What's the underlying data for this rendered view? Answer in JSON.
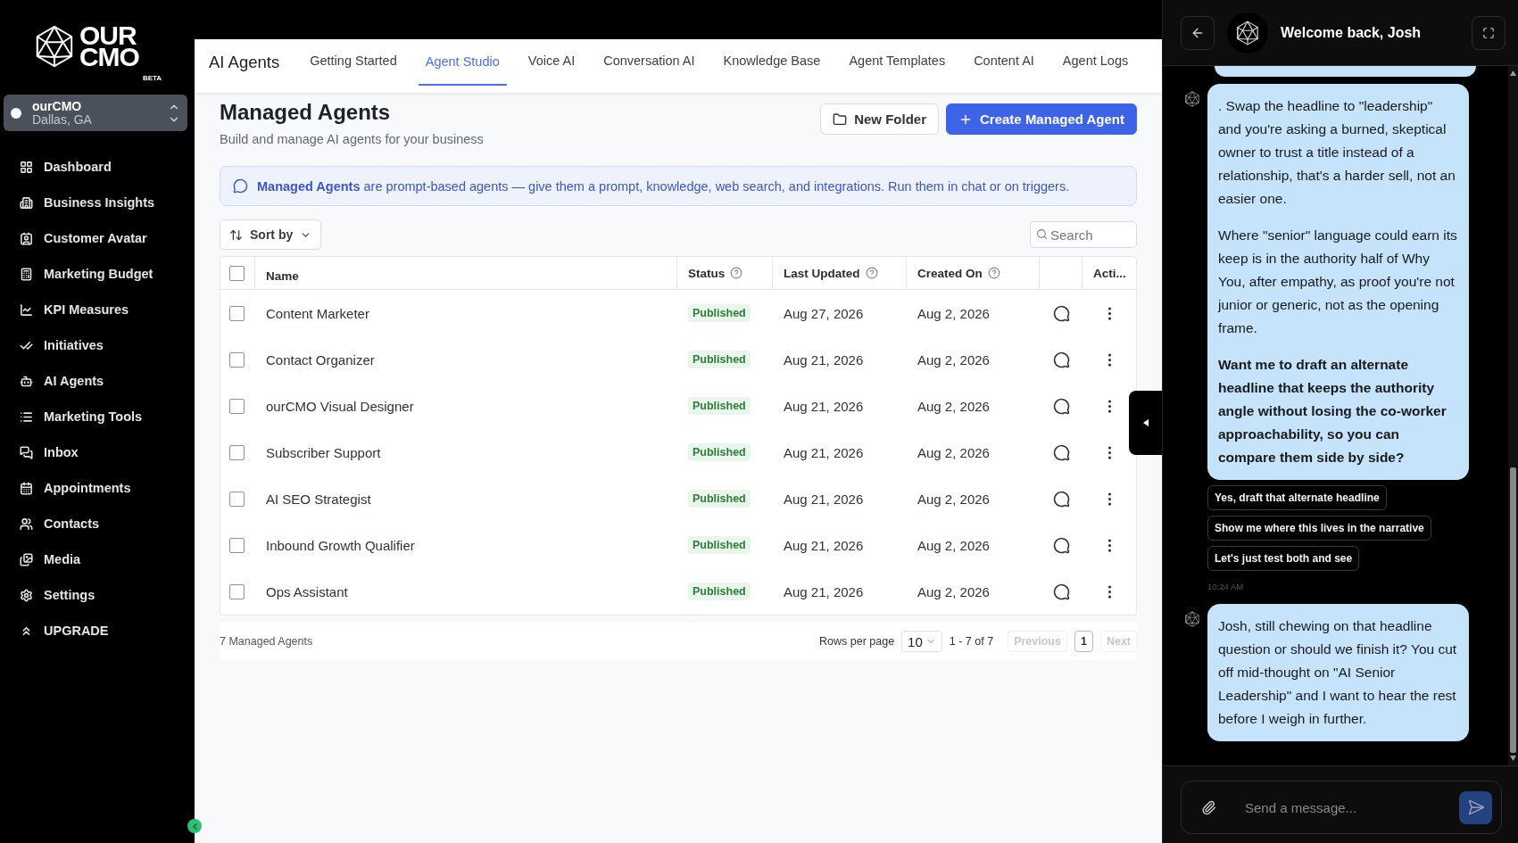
{
  "logo": {
    "line_1": "OUR",
    "line_2": "CMO",
    "badge": "BETA"
  },
  "org_switcher": {
    "name": "ourCMO",
    "location": "Dallas, GA"
  },
  "sidebar": {
    "items": [
      {
        "label": "Dashboard"
      },
      {
        "label": "Business Insights"
      },
      {
        "label": "Customer Avatar"
      },
      {
        "label": "Marketing Budget"
      },
      {
        "label": "KPI Measures"
      },
      {
        "label": "Initiatives"
      },
      {
        "label": "AI Agents"
      },
      {
        "label": "Marketing Tools"
      },
      {
        "label": "Inbox"
      },
      {
        "label": "Appointments"
      },
      {
        "label": "Contacts"
      },
      {
        "label": "Media"
      },
      {
        "label": "Settings"
      },
      {
        "label": "UPGRADE"
      }
    ]
  },
  "section_title": "AI Agents",
  "tabs": [
    {
      "label": "Getting Started",
      "selected": false
    },
    {
      "label": "Agent Studio",
      "selected": true
    },
    {
      "label": "Voice AI",
      "selected": false
    },
    {
      "label": "Conversation AI",
      "selected": false
    },
    {
      "label": "Knowledge Base",
      "selected": false
    },
    {
      "label": "Agent Templates",
      "selected": false
    },
    {
      "label": "Content AI",
      "selected": false
    },
    {
      "label": "Agent Logs",
      "selected": false
    }
  ],
  "page": {
    "title": "Managed Agents",
    "subtitle": "Build and manage AI agents for your business",
    "buttons": [
      {
        "kind": "secondary",
        "label": "New Folder"
      },
      {
        "kind": "primary",
        "label": "Create Managed Agent"
      }
    ]
  },
  "notice": "**Managed Agents** are prompt-based agents — give them a prompt, knowledge, web search, and integrations. Run them in chat or on triggers.",
  "sort": {
    "label": "Sort by"
  },
  "search": {
    "placeholder": "Search"
  },
  "table": {
    "columns": [
      "Name",
      "Status",
      "Last Updated",
      "Created On",
      "Acti..."
    ],
    "rows": [
      {
        "checked": false,
        "name": "Content Marketer",
        "status": "Published",
        "updated": "Aug 27, 2026",
        "created": "Aug 2, 2026"
      },
      {
        "checked": false,
        "name": "Contact Organizer",
        "status": "Published",
        "updated": "Aug 21, 2026",
        "created": "Aug 2, 2026"
      },
      {
        "checked": false,
        "name": "ourCMO Visual Designer",
        "status": "Published",
        "updated": "Aug 21, 2026",
        "created": "Aug 2, 2026"
      },
      {
        "checked": false,
        "name": "Subscriber Support",
        "status": "Published",
        "updated": "Aug 21, 2026",
        "created": "Aug 2, 2026"
      },
      {
        "checked": false,
        "name": "AI SEO Strategist",
        "status": "Published",
        "updated": "Aug 21, 2026",
        "created": "Aug 2, 2026"
      },
      {
        "checked": false,
        "name": "Inbound Growth Qualifier",
        "status": "Published",
        "updated": "Aug 21, 2026",
        "created": "Aug 2, 2026"
      },
      {
        "checked": false,
        "name": "Ops Assistant",
        "status": "Published",
        "updated": "Aug 21, 2026",
        "created": "Aug 2, 2026"
      }
    ],
    "all_checked": false
  },
  "footer": {
    "count": "7 Managed Agents",
    "rows_per_page_label": "Rows per page",
    "rows_per_page": "10",
    "range": "1 - 7 of 7",
    "pages": [
      {
        "label": "1",
        "selected": true
      }
    ],
    "previous": {
      "label": "Previous",
      "disabled": true
    },
    "next": {
      "label": "Next",
      "disabled": true
    }
  },
  "chat": {
    "title": "Welcome back, Josh",
    "messages": [
      {
        "paragraphs": [
          {
            "text": ". Swap the headline to \"leadership\" and you're asking a burned, skeptical owner to trust a title instead of a relationship, that's a harder sell, not an easier one.",
            "bold": false
          },
          {
            "text": "Where \"senior\" language could earn its keep is in the authority half of Why You, after empathy, as proof you're not junior or generic, not as the opening frame.",
            "bold": false
          },
          {
            "text": "Want me to draft an alternate headline that keeps the authority angle without losing the co-worker approachability, so you can compare them side by side?",
            "bold": true
          }
        ],
        "suggestions": [
          "Yes, draft that alternate headline",
          "Show me where this lives in the narrative",
          "Let's just test both and see"
        ],
        "time": "10:24 AM"
      },
      {
        "paragraphs": [
          {
            "text": "Josh, still chewing on that headline question or should we finish it? You cut off mid-thought on \"AI Senior Leadership\" and I want to hear the rest before I weigh in further.",
            "bold": false
          }
        ]
      }
    ],
    "input": {
      "placeholder": "Send a message..."
    }
  }
}
